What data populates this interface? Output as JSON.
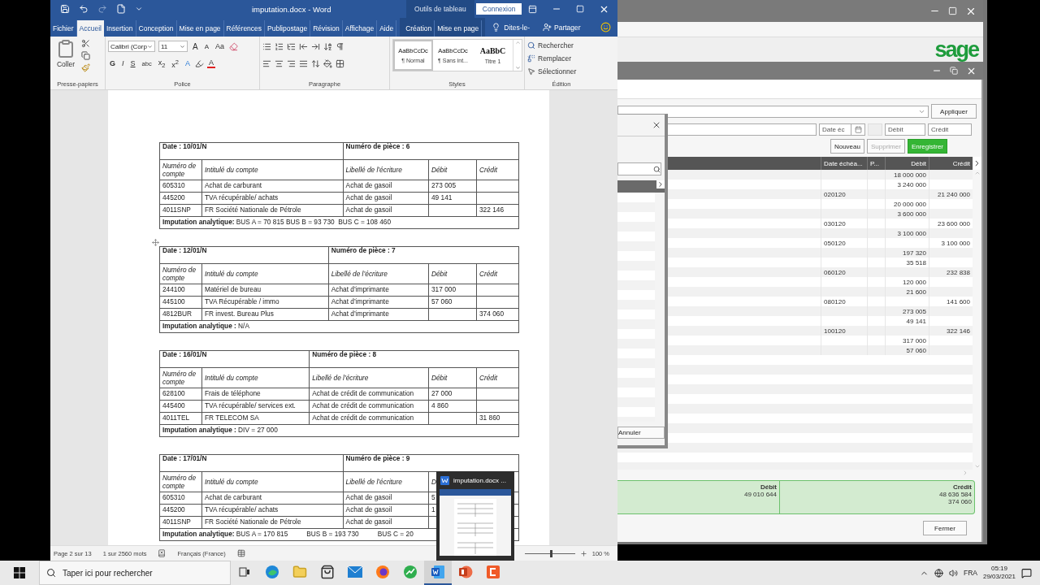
{
  "word": {
    "title": "imputation.docx  -  Word",
    "context_label": "Outils de tableau",
    "signin": "Connexion",
    "tabs": [
      {
        "label": "Fichier",
        "selected": false
      },
      {
        "label": "Accueil",
        "selected": true
      },
      {
        "label": "Insertion",
        "selected": false
      },
      {
        "label": "Conception",
        "selected": false
      },
      {
        "label": "Mise en page",
        "selected": false
      },
      {
        "label": "Références",
        "selected": false
      },
      {
        "label": "Publipostage",
        "selected": false
      },
      {
        "label": "Révision",
        "selected": false
      },
      {
        "label": "Affichage",
        "selected": false
      },
      {
        "label": "Aide",
        "selected": false
      }
    ],
    "table_tabs": [
      {
        "label": "Création",
        "selected": false
      },
      {
        "label": "Mise en page",
        "selected": false
      }
    ],
    "tell_me": "Dites-le-",
    "share": "Partager",
    "ribbon": {
      "clipboard": {
        "paste": "Coller",
        "label": "Presse-papiers"
      },
      "font": {
        "family": "Calibri (Corp",
        "size": "11",
        "grow": "A",
        "shrink": "A",
        "case": "Aa",
        "format_buttons": [
          "G",
          "I",
          "S",
          "abc",
          "x$_{2}$",
          "x$^{2}$"
        ],
        "effects": "A",
        "font_color": "A",
        "label": "Police"
      },
      "paragraph": {
        "label": "Paragraphe"
      },
      "styles": {
        "items": [
          {
            "preview": "AaBbCcDc",
            "name": "¶ Normal",
            "selected": true
          },
          {
            "preview": "AaBbCcDc",
            "name": "¶ Sans int...",
            "selected": false
          },
          {
            "preview": "AaBbC",
            "name": "Titre 1",
            "selected": false
          }
        ],
        "label": "Styles"
      },
      "editing": {
        "items": [
          {
            "label": "Rechercher",
            "kind": "find"
          },
          {
            "label": "Remplacer",
            "kind": "replace"
          },
          {
            "label": "Sélectionner",
            "kind": "select"
          }
        ],
        "label": "Édition"
      }
    },
    "tables": [
      {
        "date": "Date : 10/01/N",
        "piece": "Numéro de pièce : 6",
        "headers": [
          "Numéro de compte",
          "Intitulé du compte",
          "Libellé de l’écriture",
          "Débit",
          "Crédit"
        ],
        "rows": [
          [
            "605310",
            "Achat de carburant",
            "Achat de gasoil",
            "273 005",
            null
          ],
          [
            "445200",
            "TVA récupérable/ achats",
            "Achat de gasoil",
            "49 141",
            null
          ],
          [
            "4011SNP",
            "FR Société Nationale de Pétrole",
            "Achat de gasoil",
            null,
            "322 146"
          ]
        ],
        "imputation": "**Imputation analytique:** BUS A = 70 815 BUS B = 93 730  BUS C = 108 460"
      },
      {
        "date": "Date : 12/01/N",
        "piece": "Numéro de pièce : 7",
        "headers": [
          "Numéro de compte",
          "Intitulé du compte",
          "Libellé de l’écriture",
          "Débit",
          "Crédit"
        ],
        "rows": [
          [
            "244100",
            "Matériel de bureau",
            "Achat d’imprimante",
            "317 000",
            null
          ],
          [
            "445100",
            "TVA Récupérable / immo",
            "Achat d’imprimante",
            "57 060",
            null
          ],
          [
            "4812BUR",
            "FR invest. Bureau Plus",
            "Achat d’imprimante",
            null,
            "374 060"
          ]
        ],
        "imputation": "**Imputation analytique :** N/A"
      },
      {
        "date": "Date : 16/01/N",
        "piece": "Numéro de pièce : 8",
        "headers": [
          "Numéro de compte",
          "Intitulé du compte",
          "Libellé de l’écriture",
          "Débit",
          "Crédit"
        ],
        "rows": [
          [
            "628100",
            "Frais de téléphone",
            "Achat de crédit de communication",
            "27 000",
            null
          ],
          [
            "445400",
            "TVA récupérable/ services ext.",
            "Achat de crédit de communication",
            "4 860",
            null
          ],
          [
            "4011TEL",
            "FR TELECOM SA",
            "Achat de crédit de communication",
            null,
            "31 860"
          ]
        ],
        "imputation": "**Imputation analytique :** DIV = 27 000"
      },
      {
        "date": "Date : 17/01/N",
        "piece": "Numéro de pièce : 9",
        "headers": [
          "Numéro de compte",
          "Intitulé du compte",
          "Libellé de l’écriture",
          "D"
        ],
        "rows": [
          [
            "605310",
            "Achat de carburant",
            "Achat de gasoil",
            "5",
            null
          ],
          [
            "445200",
            "TVA récupérable/ achats",
            "Achat de gasoil",
            "1",
            null
          ],
          [
            "4011SNP",
            "FR Société Nationale de Pétrole",
            "Achat de gasoil",
            null,
            null
          ]
        ],
        "imputation": "**Imputation analytique:** BUS A = 170 815          BUS B = 193 730          BUS C = 20"
      }
    ],
    "status_bar": {
      "page": "Page 2 sur 13",
      "words": "1 sur 2560 mots",
      "language": "Français (France)",
      "zoom_slider": {
        "level": 0.5
      },
      "zoom": "100 %"
    }
  },
  "preview_popup": {
    "title": "imputation.docx ..."
  },
  "sage": {
    "logo": "sage",
    "apply": "Appliquer",
    "date_field": {
      "placeholder": "Date éc"
    },
    "debit_field": {
      "placeholder": "Débit"
    },
    "credit_field": {
      "placeholder": "Crédit"
    },
    "buttons": [
      {
        "label": "Nouveau",
        "kind": "default",
        "disabled": false
      },
      {
        "label": "Supprimer",
        "kind": "default",
        "disabled": true
      },
      {
        "label": "Enregistrer",
        "kind": "primary",
        "disabled": false
      }
    ],
    "columns": [
      "Date échéa...",
      "P...",
      "Débit",
      "Crédit"
    ],
    "rows": [
      {
        "debit": "18 000 000"
      },
      {
        "debit": "3 240 000"
      },
      {
        "date": "020120",
        "credit": "21 240 000"
      },
      {
        "debit": "20 000 000"
      },
      {
        "debit": "3 600 000"
      },
      {
        "date": "030120",
        "credit": "23 600 000"
      },
      {
        "debit": "3 100 000"
      },
      {
        "date": "050120",
        "credit": "3 100 000"
      },
      {
        "debit": "197 320"
      },
      {
        "debit": "35 518"
      },
      {
        "date": "060120",
        "credit": "232 838"
      },
      {
        "debit": "120 000"
      },
      {
        "debit": "21 600"
      },
      {
        "date": "080120",
        "credit": "141 600"
      },
      {
        "debit": "273 005"
      },
      {
        "debit": "49 141"
      },
      {
        "date": "100120",
        "credit": "322 146"
      },
      {
        "debit": "317 000"
      },
      {
        "debit": "57 060"
      }
    ],
    "totals": {
      "debit_label": "Débit",
      "debit": "49 010 644",
      "credit_label": "Crédit",
      "credit": "48 636 584",
      "balance": "374 060"
    },
    "close": "Fermer",
    "dialog": {
      "cancel": "Annuler"
    }
  },
  "taskbar": {
    "search": {
      "placeholder": "Taper ici pour rechercher"
    },
    "apps": [
      {
        "kind": "taskview",
        "selected": false
      },
      {
        "kind": "edge",
        "selected": false
      },
      {
        "kind": "folder",
        "selected": false
      },
      {
        "kind": "store",
        "selected": false
      },
      {
        "kind": "mail",
        "selected": false
      },
      {
        "kind": "firefox",
        "selected": false
      },
      {
        "kind": "green",
        "selected": false
      },
      {
        "kind": "word",
        "selected": true
      },
      {
        "kind": "powerpoint",
        "selected": false
      },
      {
        "kind": "orange",
        "selected": false
      }
    ],
    "language": "FRA",
    "time": "05:19",
    "date": "29/03/2021"
  }
}
